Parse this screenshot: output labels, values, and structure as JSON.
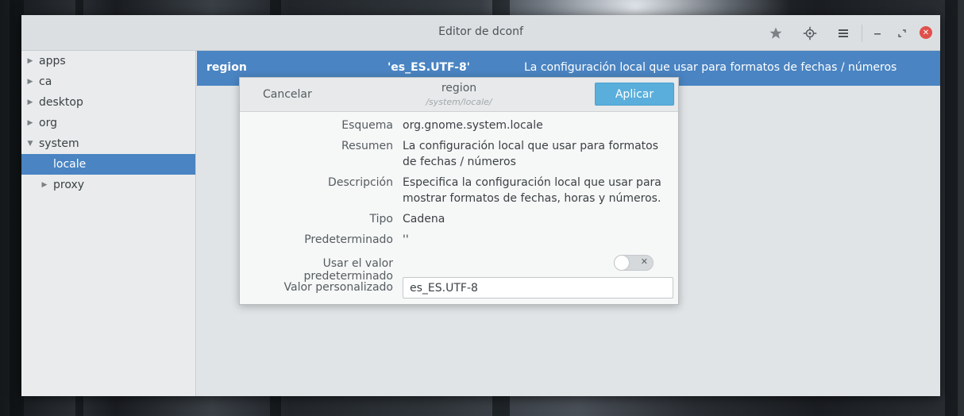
{
  "window": {
    "title": "Editor de dconf"
  },
  "toolbar": {
    "bookmark_icon": "star-icon",
    "search_icon": "target-icon",
    "menu_icon": "hamburger-menu-icon"
  },
  "sidebar": {
    "items": [
      {
        "label": "apps",
        "expander": "collapsed"
      },
      {
        "label": "ca",
        "expander": "collapsed"
      },
      {
        "label": "desktop",
        "expander": "collapsed"
      },
      {
        "label": "org",
        "expander": "collapsed"
      },
      {
        "label": "system",
        "expander": "expanded"
      },
      {
        "label": "locale",
        "selected": true
      },
      {
        "label": "proxy",
        "expander": "collapsed"
      }
    ]
  },
  "key_row": {
    "name": "region",
    "value": "'es_ES.UTF-8'",
    "summary": "La configuración local que usar para formatos de fechas / números"
  },
  "dialog": {
    "cancel_label": "Cancelar",
    "title": "region",
    "subtitle": "/system/locale/",
    "apply_label": "Aplicar",
    "fields": {
      "schema_label": "Esquema",
      "schema_value": "org.gnome.system.locale",
      "summary_label": "Resumen",
      "summary_value": "La configuración local que usar para formatos de fechas / números",
      "description_label": "Descripción",
      "description_value": "Especifica la configuración local que usar para mostrar formatos de fechas, horas y números.",
      "type_label": "Tipo",
      "type_value": "Cadena",
      "default_label": "Predeterminado",
      "default_value": "''",
      "use_default_label": "Usar el valor predeterminado",
      "use_default_state": "off",
      "custom_label": "Valor personalizado",
      "custom_value": "es_ES.UTF-8"
    }
  },
  "colors": {
    "accent": "#4a84c2",
    "apply": "#5aaedb",
    "close": "#e0504b"
  }
}
